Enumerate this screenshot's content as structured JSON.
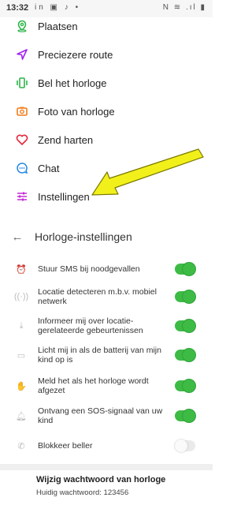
{
  "status_bar": {
    "time": "13:32",
    "left_icons": "in ▣ ♪ •",
    "right_icons": "N ≋ .ıl ▮"
  },
  "menu": {
    "items": [
      {
        "label": "Plaatsen",
        "icon": "location-pin-icon",
        "color": "#2db34a"
      },
      {
        "label": "Preciezere route",
        "icon": "navigation-arrow-icon",
        "color": "#a020f0"
      },
      {
        "label": "Bel het horloge",
        "icon": "phone-vibrate-icon",
        "color": "#2db34a"
      },
      {
        "label": "Foto van horloge",
        "icon": "camera-icon",
        "color": "#f07c1a"
      },
      {
        "label": "Zend harten",
        "icon": "heart-icon",
        "color": "#e8233a"
      },
      {
        "label": "Chat",
        "icon": "chat-bubble-icon",
        "color": "#1f86e6"
      },
      {
        "label": "Instellingen",
        "icon": "sliders-icon",
        "color": "#c42bd6"
      }
    ]
  },
  "annotation": {
    "arrow_color": "#f2f01a",
    "arrow_outline": "#7a7a00"
  },
  "settings": {
    "title": "Horloge-instellingen",
    "back_icon": "back-arrow-icon",
    "rows": [
      {
        "label": "Stuur SMS bij noodgevallen",
        "icon": "alarm-icon",
        "enabled": true
      },
      {
        "label": "Locatie detecteren m.b.v. mobiel netwerk",
        "icon": "signal-icon",
        "enabled": true
      },
      {
        "label": "Informeer mij over locatie-gerelateerde gebeurtenissen",
        "icon": "location-event-icon",
        "enabled": true
      },
      {
        "label": "Licht mij in als de batterij van mijn kind op is",
        "icon": "battery-icon",
        "enabled": true
      },
      {
        "label": "Meld het als het horloge wordt afgezet",
        "icon": "hand-icon",
        "enabled": true
      },
      {
        "label": "Ontvang een SOS-signaal van uw kind",
        "icon": "bell-icon",
        "enabled": true
      },
      {
        "label": "Blokkeer beller",
        "icon": "block-call-icon",
        "enabled": false
      }
    ],
    "toggle_on_color": "#3dbb45"
  },
  "password": {
    "title": "Wijzig wachtwoord van horloge",
    "current": "Huidig wachtwoord: 123456"
  }
}
